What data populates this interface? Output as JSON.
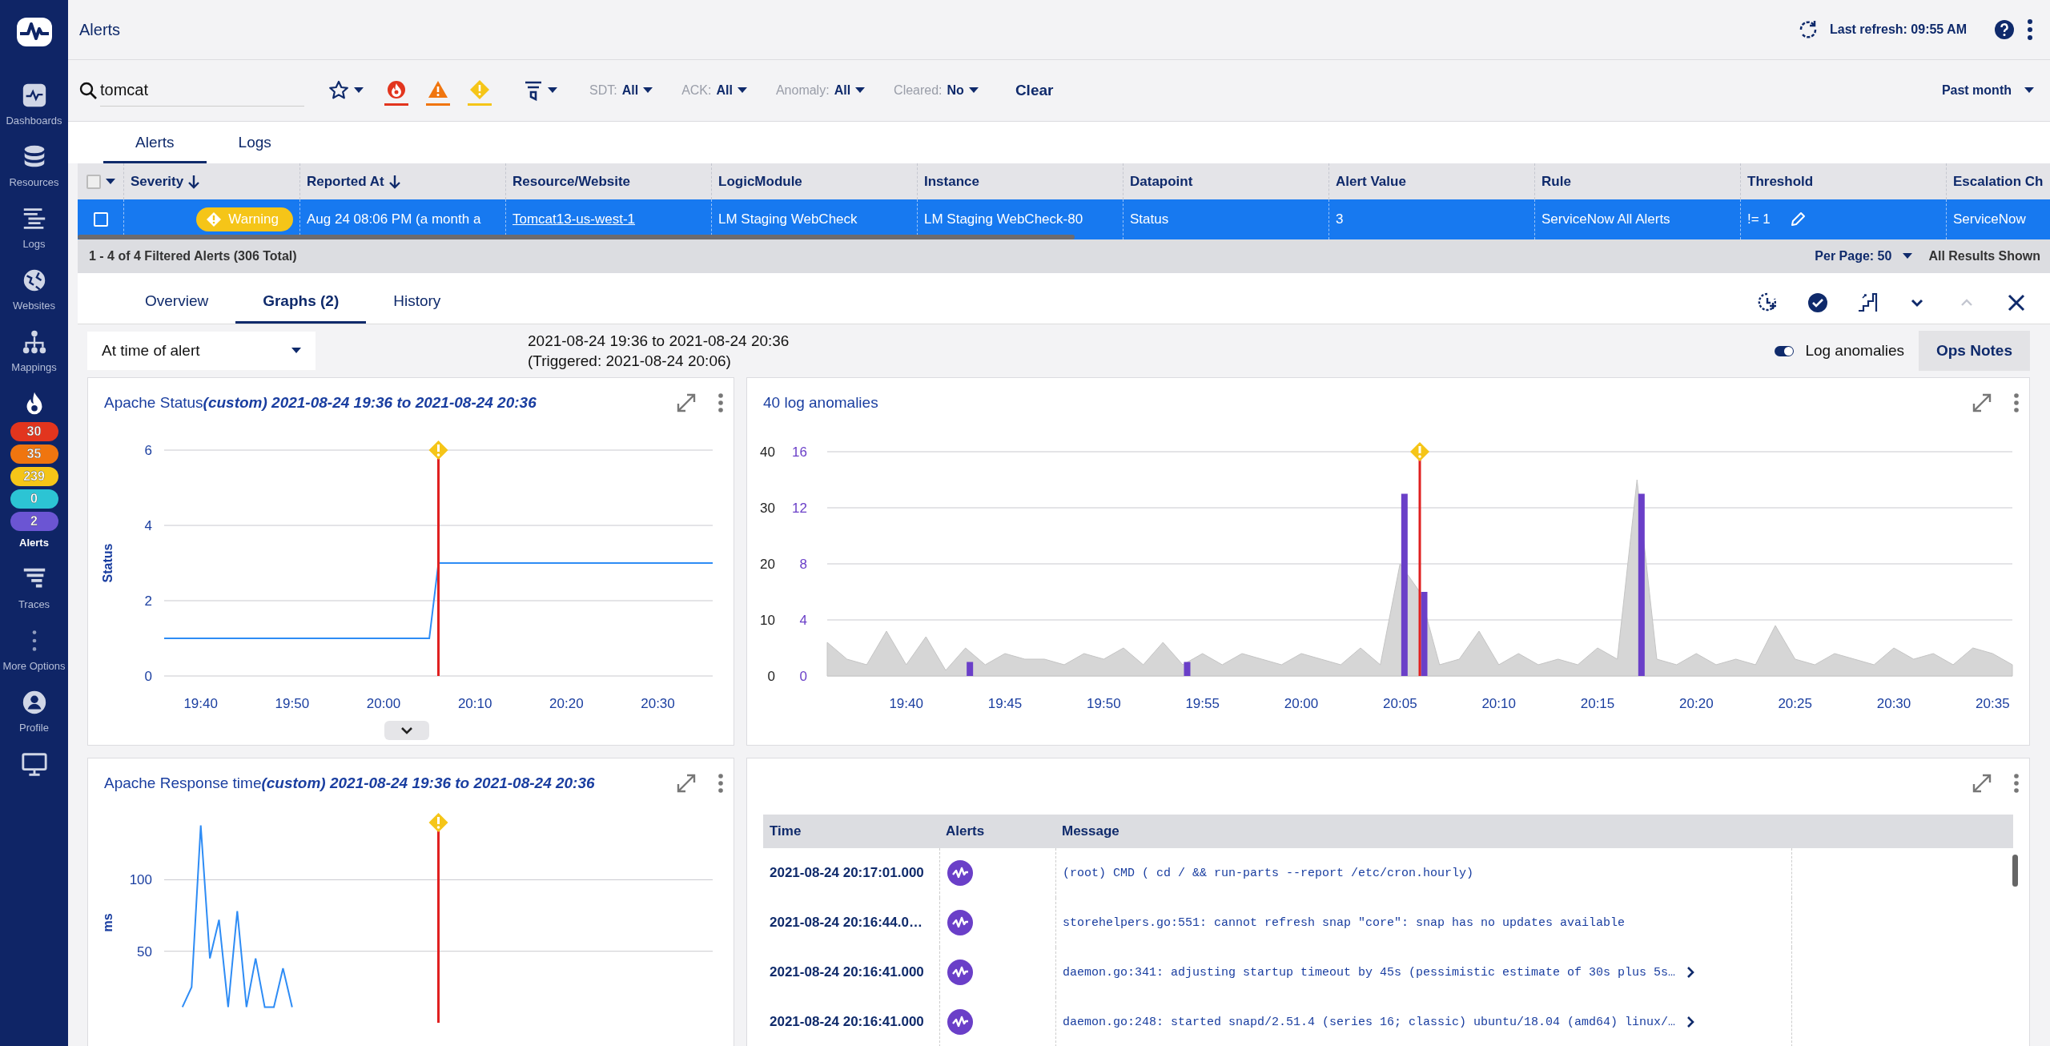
{
  "sidebar": {
    "items": [
      {
        "kind": "dashboards",
        "label": "Dashboards",
        "selected": false
      },
      {
        "kind": "resources",
        "label": "Resources",
        "selected": false
      },
      {
        "kind": "logs",
        "label": "Logs",
        "selected": false
      },
      {
        "kind": "websites",
        "label": "Websites",
        "selected": false
      },
      {
        "kind": "mappings",
        "label": "Mappings",
        "selected": false
      },
      {
        "kind": "alerts",
        "label": "Alerts",
        "selected": true,
        "badges": [
          {
            "count": "30",
            "color": "#e2351e"
          },
          {
            "count": "35",
            "color": "#f0750f"
          },
          {
            "count": "239",
            "color": "#f5c518"
          },
          {
            "count": "0",
            "color": "#2cc4d4"
          },
          {
            "count": "2",
            "color": "#6b55d3"
          }
        ]
      },
      {
        "kind": "traces",
        "label": "Traces",
        "selected": false
      },
      {
        "kind": "more",
        "label": "More Options",
        "selected": false
      },
      {
        "kind": "profile",
        "label": "Profile",
        "selected": false
      },
      {
        "kind": "monitor",
        "selected": false
      }
    ]
  },
  "header": {
    "title": "Alerts",
    "last_refresh": "Last refresh: 09:55 AM"
  },
  "filters": {
    "search": {
      "value": "tomcat"
    },
    "severity": [
      {
        "kind": "critical",
        "color": "#e2351e",
        "selected": true
      },
      {
        "kind": "error",
        "color": "#f0750f",
        "selected": true
      },
      {
        "kind": "warning",
        "color": "#f5c518",
        "selected": true
      }
    ],
    "dropdowns": [
      {
        "label": "SDT:",
        "value": "All"
      },
      {
        "label": "ACK:",
        "value": "All"
      },
      {
        "label": "Anomaly:",
        "value": "All"
      },
      {
        "label": "Cleared:",
        "value": "No"
      }
    ],
    "clear": "Clear",
    "time_range": "Past month"
  },
  "view_tabs": [
    {
      "label": "Alerts",
      "selected": true
    },
    {
      "label": "Logs",
      "selected": false
    }
  ],
  "table": {
    "select_all": {
      "checked": false
    },
    "columns": [
      {
        "label": "Severity",
        "sorted": true
      },
      {
        "label": "Reported At",
        "sorted": true
      },
      {
        "label": "Resource/Website",
        "sorted": false
      },
      {
        "label": "LogicModule",
        "sorted": false
      },
      {
        "label": "Instance",
        "sorted": false
      },
      {
        "label": "Datapoint",
        "sorted": false
      },
      {
        "label": "Alert Value",
        "sorted": false
      },
      {
        "label": "Rule",
        "sorted": false
      },
      {
        "label": "Threshold",
        "sorted": false
      },
      {
        "label": "Escalation Ch",
        "sorted": false
      }
    ],
    "rows": [
      {
        "selected": true,
        "checked": false,
        "cells": [
          {
            "kind": "severity",
            "text": "Warning"
          },
          {
            "kind": "text",
            "text": "Aug 24 08:06 PM  (a month a"
          },
          {
            "kind": "link",
            "text": "Tomcat13-us-west-1"
          },
          {
            "kind": "text",
            "text": "LM Staging WebCheck"
          },
          {
            "kind": "text",
            "text": "LM Staging WebCheck-80"
          },
          {
            "kind": "text",
            "text": "Status"
          },
          {
            "kind": "text",
            "text": "3"
          },
          {
            "kind": "text",
            "text": "ServiceNow All Alerts"
          },
          {
            "kind": "threshold",
            "text": "!= 1"
          },
          {
            "kind": "text",
            "text": "ServiceNow"
          }
        ]
      }
    ]
  },
  "summary": "1 - 4 of 4 Filtered Alerts (306 Total)",
  "per_page": "Per Page: 50",
  "results": "All Results Shown",
  "detail": {
    "tabs": [
      {
        "label": "Overview",
        "selected": false
      },
      {
        "label": "Graphs (2)",
        "selected": true
      },
      {
        "label": "History",
        "selected": false
      }
    ],
    "actions": [
      {
        "kind": "snooze",
        "disabled": false
      },
      {
        "kind": "acknowledge",
        "disabled": false
      },
      {
        "kind": "escalate",
        "disabled": false
      },
      {
        "kind": "next",
        "disabled": false
      },
      {
        "kind": "previous",
        "disabled": true
      },
      {
        "kind": "close",
        "disabled": false
      }
    ],
    "time_select": "At time of alert",
    "range": "2021-08-24 19:36 to 2021-08-24 20:36",
    "triggered": "(Triggered: 2021-08-24 20:06)",
    "log_anomalies": {
      "label": "Log anomalies",
      "on": true
    },
    "ops_notes": "Ops Notes"
  },
  "graphs": [
    {
      "title": "Apache Status",
      "subtitle": "(custom) 2021-08-24 19:36 to 2021-08-24 20:36",
      "more": true,
      "chart_data": {
        "type": "line",
        "ylabel": "Status",
        "x": [
          1176,
          1205,
          1206,
          1236
        ],
        "values": [
          1,
          1,
          3,
          3
        ],
        "xlim": [
          1176,
          1236
        ],
        "ylim": [
          0,
          6
        ],
        "yticks": [
          0,
          2,
          4,
          6
        ],
        "grid": true,
        "xticks": [
          {
            "value": 1180,
            "label": "19:40"
          },
          {
            "value": 1190,
            "label": "19:50"
          },
          {
            "value": 1200,
            "label": "20:00"
          },
          {
            "value": 1210,
            "label": "20:10"
          },
          {
            "value": 1220,
            "label": "20:20"
          },
          {
            "value": 1230,
            "label": "20:30"
          }
        ],
        "ref_lines": [
          {
            "axis": "x",
            "value": 1206,
            "color": "#e02020"
          }
        ]
      }
    },
    {
      "title": "40 log anomalies",
      "chart_data": {
        "type": "area",
        "x": [
          1176,
          1177,
          1178,
          1179,
          1180,
          1181,
          1182,
          1183,
          1184,
          1185,
          1186,
          1187,
          1188,
          1189,
          1190,
          1191,
          1192,
          1193,
          1194,
          1195,
          1196,
          1197,
          1198,
          1199,
          1200,
          1201,
          1202,
          1203,
          1204,
          1205,
          1206,
          1207,
          1208,
          1209,
          1210,
          1211,
          1212,
          1213,
          1214,
          1215,
          1216,
          1217,
          1218,
          1219,
          1220,
          1221,
          1222,
          1223,
          1224,
          1225,
          1226,
          1227,
          1228,
          1229,
          1230,
          1231,
          1232,
          1233,
          1234,
          1235,
          1236
        ],
        "series": [
          {
            "color": "#d6d6d6",
            "values": [
              6,
              3,
              2,
              8,
              2,
              7,
              1,
              5,
              2,
              4,
              3,
              3,
              2,
              4,
              3,
              5,
              2,
              6,
              2,
              4,
              2,
              4,
              3,
              2,
              4,
              3,
              2,
              5,
              2,
              20,
              15,
              2,
              3,
              8,
              2,
              4,
              2,
              3,
              2,
              5,
              3,
              35,
              3,
              2,
              4,
              2,
              3,
              2,
              9,
              3,
              2,
              4,
              3,
              2,
              5,
              3,
              4,
              2,
              5,
              4,
              2
            ]
          },
          {
            "type": "bar",
            "axis": "y2",
            "color": "#6a3fc8",
            "values": [
              null,
              null,
              null,
              null,
              null,
              null,
              null,
              1,
              null,
              null,
              null,
              null,
              null,
              null,
              null,
              null,
              null,
              null,
              1,
              null,
              null,
              null,
              null,
              null,
              null,
              null,
              null,
              null,
              null,
              13,
              6,
              null,
              null,
              null,
              null,
              null,
              null,
              null,
              null,
              null,
              null,
              13,
              null,
              null,
              null,
              null,
              null,
              null,
              null,
              null,
              null,
              null,
              null,
              null,
              null,
              null,
              null,
              null,
              null,
              null,
              null
            ]
          }
        ],
        "xlim": [
          1176,
          1236
        ],
        "ylim": [
          0,
          40
        ],
        "yticks": [
          0,
          10,
          20,
          30,
          40
        ],
        "grid": true,
        "y2lim": [
          0,
          16
        ],
        "y2ticks": [
          0,
          4,
          8,
          12,
          16
        ],
        "xticks": [
          {
            "value": 1180,
            "label": "19:40"
          },
          {
            "value": 1185,
            "label": "19:45"
          },
          {
            "value": 1190,
            "label": "19:50"
          },
          {
            "value": 1195,
            "label": "19:55"
          },
          {
            "value": 1200,
            "label": "20:00"
          },
          {
            "value": 1205,
            "label": "20:05"
          },
          {
            "value": 1210,
            "label": "20:10"
          },
          {
            "value": 1215,
            "label": "20:15"
          },
          {
            "value": 1220,
            "label": "20:20"
          },
          {
            "value": 1225,
            "label": "20:25"
          },
          {
            "value": 1230,
            "label": "20:30"
          },
          {
            "value": 1235,
            "label": "20:35"
          }
        ],
        "ref_lines": [
          {
            "axis": "x",
            "value": 1206,
            "color": "#e02020"
          }
        ]
      }
    },
    {
      "title": "Apache Response time",
      "subtitle": "(custom) 2021-08-24 19:36 to 2021-08-24 20:36",
      "chart_data": {
        "type": "line",
        "ylabel": "ms",
        "x": [
          1178,
          1179,
          1180,
          1181,
          1182,
          1183,
          1184,
          1185,
          1186,
          1187,
          1188,
          1189,
          1190
        ],
        "values": [
          11,
          25,
          138,
          45,
          72,
          11,
          78,
          11,
          45,
          11,
          11,
          38,
          11
        ],
        "xlim": [
          1176,
          1236
        ],
        "ylim": [
          0,
          140
        ],
        "yticks": [
          50,
          100
        ],
        "grid": true,
        "ref_lines": [
          {
            "axis": "x",
            "value": 1206,
            "color": "#e02020"
          }
        ]
      }
    }
  ],
  "log_table": {
    "columns": [
      "Time",
      "Alerts",
      "Message"
    ],
    "rows": [
      {
        "time": "2021-08-24 20:17:01.000",
        "message": "(root) CMD ( cd / && run-parts --report /etc/cron.hourly)",
        "expandable": false
      },
      {
        "time": "2021-08-24 20:16:44.0…",
        "message": "storehelpers.go:551: cannot refresh snap \"core\": snap has no updates available",
        "expandable": false
      },
      {
        "time": "2021-08-24 20:16:41.000",
        "message": "daemon.go:341: adjusting startup timeout by 45s (pessimistic estimate of 30s plus 5s…",
        "expandable": true
      },
      {
        "time": "2021-08-24 20:16:41.000",
        "message": "daemon.go:248: started snapd/2.51.4 (series 16; classic) ubuntu/18.04 (amd64) linux/…",
        "expandable": true
      }
    ]
  }
}
